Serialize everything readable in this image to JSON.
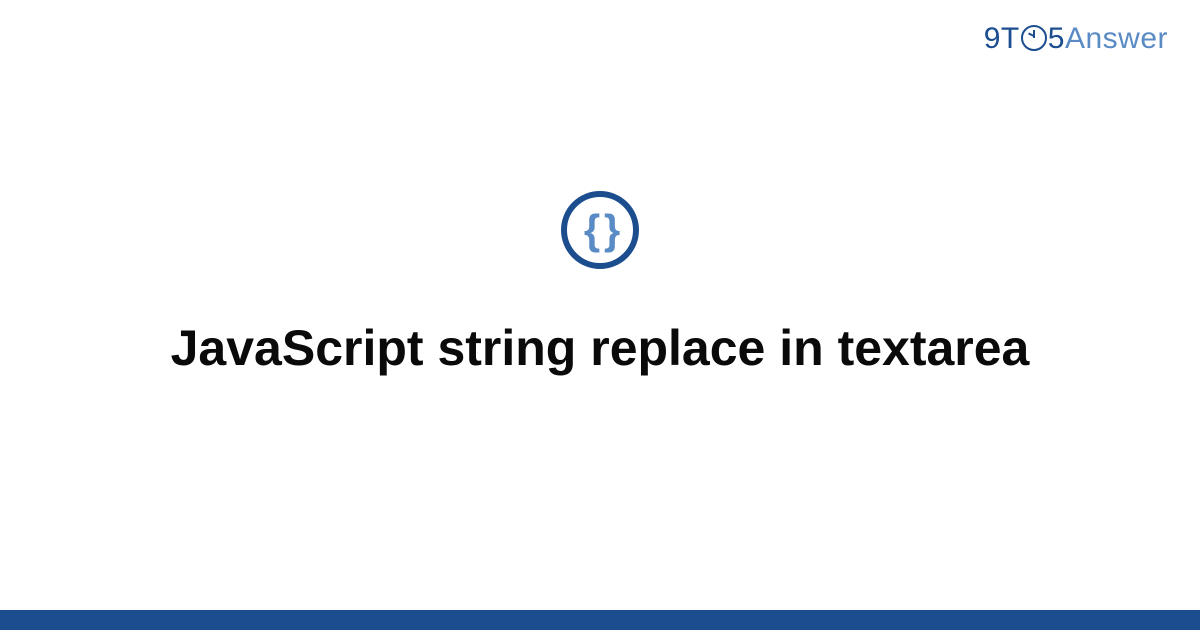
{
  "logo": {
    "part1": "9T",
    "part2": "5",
    "part3": "Answer"
  },
  "icon": {
    "glyph": "{ }"
  },
  "title": "JavaScript string replace in textarea"
}
